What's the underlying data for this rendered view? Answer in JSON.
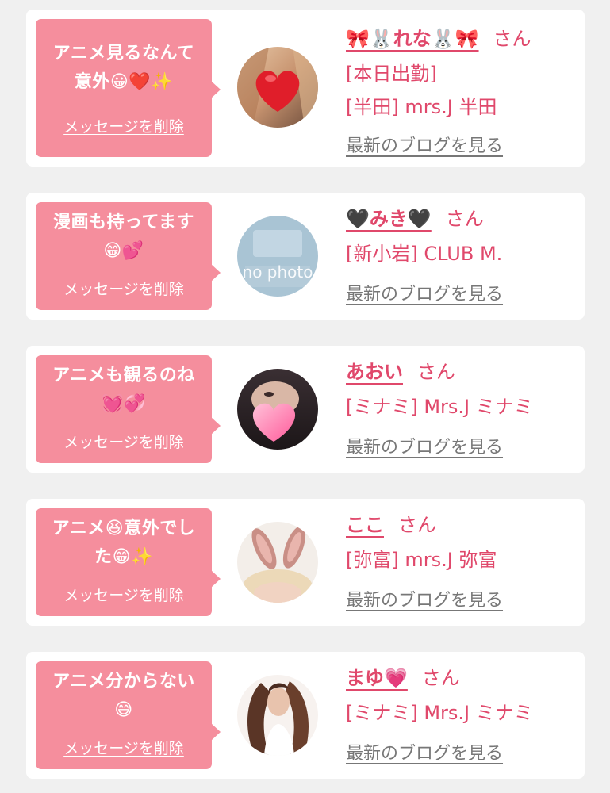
{
  "colors": {
    "page_bg": "#f0f0f0",
    "card_bg": "#ffffff",
    "bubble_bg": "#f58e9d",
    "accent_pink": "#e0486b",
    "blog_link": "#777777"
  },
  "delete_label": "メッセージを削除",
  "blog_label": "最新のブログを見る",
  "honorific": "さん",
  "messages": [
    {
      "message_line1": "アニメ見るなんて",
      "message_line2": "意外😀❤️✨",
      "name": "🎀🐰れな🐰🎀",
      "shop_lines": [
        "[本日出勤]",
        "[半田] mrs.J 半田"
      ],
      "avatar_icon": "heart-avatar-icon"
    },
    {
      "message_line1": "漫画も持ってます",
      "message_line2": "😁💕",
      "name": "🖤みき🖤",
      "shop_lines": [
        "[新小岩] CLUB M."
      ],
      "avatar_icon": "no-photo-icon",
      "avatar_text": "no photo"
    },
    {
      "message_line1": "アニメも観るのね",
      "message_line2": "💓💞",
      "name": "あおい",
      "shop_lines": [
        "[ミナミ] Mrs.J ミナミ"
      ],
      "avatar_icon": "pink-heart-avatar-icon"
    },
    {
      "message_line1": "アニメ😆意外でし",
      "message_line2": "た😁✨",
      "name": "ここ",
      "shop_lines": [
        "[弥富] mrs.J 弥富"
      ],
      "avatar_icon": "bunny-ears-avatar-icon"
    },
    {
      "message_line1": "アニメ分からない",
      "message_line2": "😅",
      "name": "まゆ💗",
      "shop_lines": [
        "[ミナミ] Mrs.J ミナミ"
      ],
      "avatar_icon": "portrait-avatar-icon"
    }
  ]
}
